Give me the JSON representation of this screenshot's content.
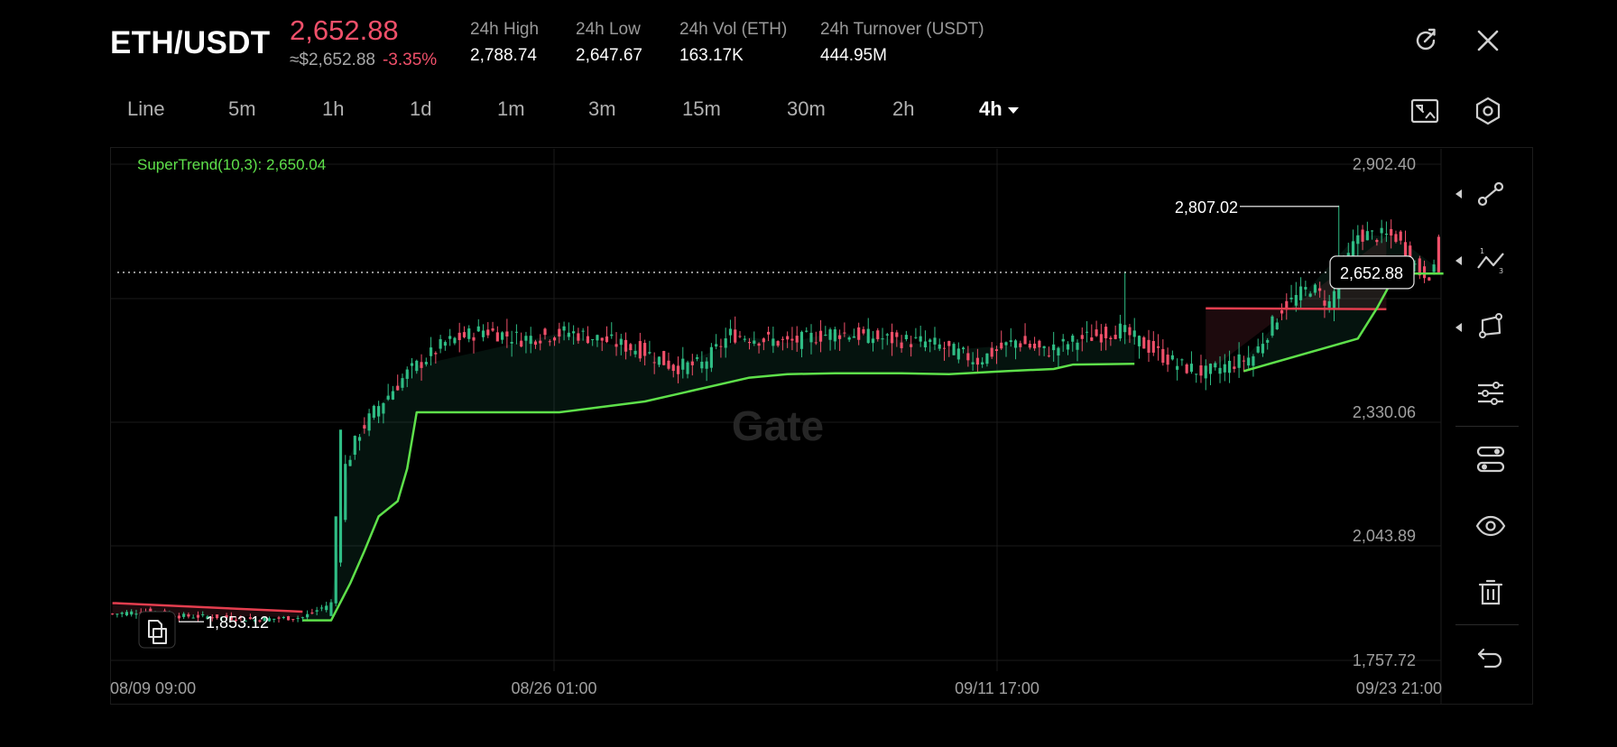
{
  "header": {
    "pair": "ETH/USDT",
    "price": "2,652.88",
    "approx_price": "≈$2,652.88",
    "change_pct": "-3.35%",
    "stats": [
      {
        "label": "24h   High",
        "value": "2,788.74"
      },
      {
        "label": "24h   Low",
        "value": "2,647.67"
      },
      {
        "label": "24h   Vol (ETH)",
        "value": "163.17K"
      },
      {
        "label": "24h   Turnover (USDT)",
        "value": "444.95M"
      }
    ]
  },
  "intervals": [
    "Line",
    "5m",
    "1h",
    "1d",
    "1m",
    "3m",
    "15m",
    "30m",
    "2h",
    "4h"
  ],
  "active_interval": "4h",
  "indicator": {
    "label": "SuperTrend(10,3): 2,650.04"
  },
  "watermark": "Gate",
  "chart_data": {
    "type": "candlestick",
    "y_ticks": [
      "2,902.40",
      "2,330.06",
      "2,043.89",
      "1,757.72"
    ],
    "x_ticks": [
      "08/09 09:00",
      "08/26 01:00",
      "09/11 17:00",
      "09/23 21:00"
    ],
    "ylim": [
      1757.72,
      2902.4
    ],
    "current_price_label": "2,652.88",
    "high_marker": {
      "label": "2,807.02",
      "value": 2807.02
    },
    "low_marker": {
      "label": "1,853.12",
      "value": 1853.12
    },
    "anchors": [
      [
        0,
        1865
      ],
      [
        8,
        1872
      ],
      [
        14,
        1860
      ],
      [
        22,
        1858
      ],
      [
        30,
        1852
      ],
      [
        40,
        1857
      ],
      [
        46,
        1890
      ],
      [
        47,
        1985
      ],
      [
        49,
        2205
      ],
      [
        52,
        2285
      ],
      [
        56,
        2345
      ],
      [
        62,
        2420
      ],
      [
        70,
        2490
      ],
      [
        78,
        2520
      ],
      [
        86,
        2500
      ],
      [
        96,
        2515
      ],
      [
        104,
        2495
      ],
      [
        112,
        2470
      ],
      [
        118,
        2435
      ],
      [
        124,
        2440
      ],
      [
        130,
        2510
      ],
      [
        142,
        2490
      ],
      [
        152,
        2515
      ],
      [
        162,
        2500
      ],
      [
        172,
        2490
      ],
      [
        182,
        2450
      ],
      [
        190,
        2495
      ],
      [
        196,
        2470
      ],
      [
        204,
        2500
      ],
      [
        212,
        2520
      ],
      [
        224,
        2440
      ],
      [
        230,
        2420
      ],
      [
        240,
        2460
      ],
      [
        246,
        2570
      ],
      [
        252,
        2620
      ],
      [
        256,
        2580
      ],
      [
        262,
        2740
      ],
      [
        270,
        2735
      ],
      [
        275,
        2652.88
      ]
    ],
    "supertrend": [
      {
        "trend": "down",
        "points": [
          [
            0,
            1890
          ],
          [
            40,
            1870
          ]
        ]
      },
      {
        "trend": "up",
        "points": [
          [
            40,
            1850
          ],
          [
            46,
            1850
          ],
          [
            50,
            1935
          ],
          [
            53,
            2010
          ],
          [
            56,
            2090
          ],
          [
            60,
            2125
          ],
          [
            62,
            2200
          ],
          [
            64,
            2330
          ],
          [
            94,
            2330
          ],
          [
            112,
            2355
          ],
          [
            118,
            2370
          ],
          [
            134,
            2410
          ],
          [
            142,
            2418
          ],
          [
            152,
            2420
          ],
          [
            166,
            2420
          ],
          [
            176,
            2418
          ],
          [
            188,
            2425
          ],
          [
            198,
            2430
          ],
          [
            202,
            2440
          ],
          [
            215,
            2442
          ]
        ]
      },
      {
        "trend": "down",
        "points": [
          [
            230,
            2570
          ],
          [
            268,
            2568
          ]
        ]
      },
      {
        "trend": "up",
        "points": [
          [
            238,
            2425
          ],
          [
            262,
            2500
          ],
          [
            266,
            2570
          ],
          [
            270,
            2650
          ],
          [
            280,
            2650
          ]
        ]
      }
    ],
    "bar_count": 280
  },
  "colors": {
    "up": "#2fbd85",
    "down": "#f0506a",
    "trend_up": "#5ee04a",
    "trend_down": "#e53e4f"
  }
}
